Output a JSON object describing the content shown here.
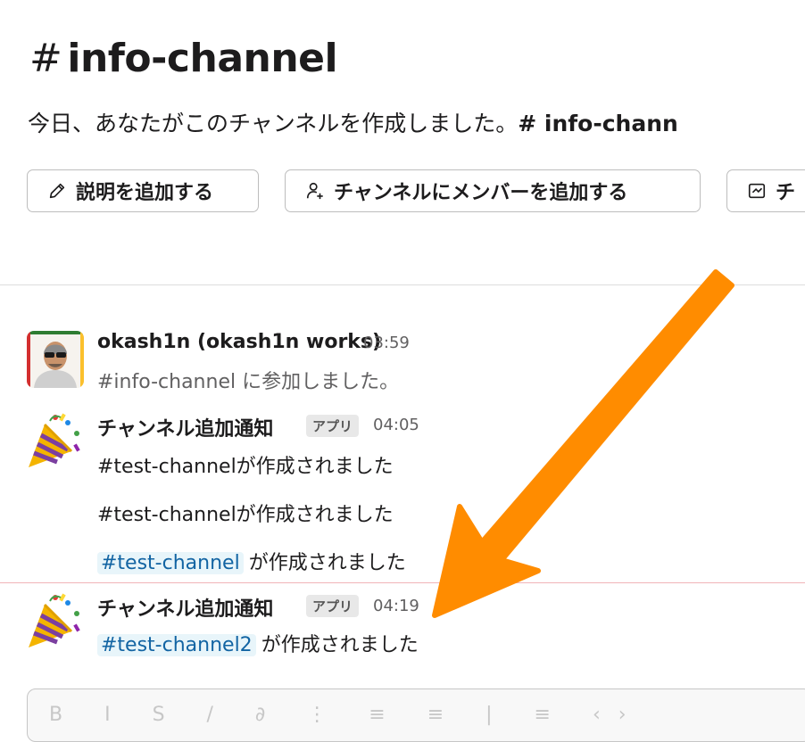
{
  "channel": {
    "hash": "#",
    "name": "info-channel",
    "intro_prefix": "今日、あなたがこのチャンネルを作成しました。",
    "intro_channel": "# info-chann"
  },
  "actions": {
    "add_description": "説明を追加する",
    "add_members": "チャンネルにメンバーを追加する",
    "third": "チ"
  },
  "messages": [
    {
      "author": "okash1n (okash1n works)",
      "time": "03:59",
      "lines": [
        "#info-channel に参加しました。"
      ]
    },
    {
      "author": "チャンネル追加通知",
      "badge": "アプリ",
      "time": "04:05",
      "lines": [
        "#test-channelが作成されました",
        "#test-channelが作成されました"
      ],
      "mention": "#test-channel",
      "mention_suffix": "が作成されました"
    },
    {
      "author": "チャンネル追加通知",
      "badge": "アプリ",
      "time": "04:19",
      "mention": "#test-channel2",
      "mention_suffix": "が作成されました"
    }
  ],
  "composer": {
    "toolbar": "B I S / ∂ ⋮ ≡ ≡ | ≡ ‹›"
  },
  "colors": {
    "arrow": "#ff8c00",
    "new_divider": "#f1b3b8",
    "mention_bg": "#e8f5fa",
    "mention_text": "#1264a3"
  }
}
